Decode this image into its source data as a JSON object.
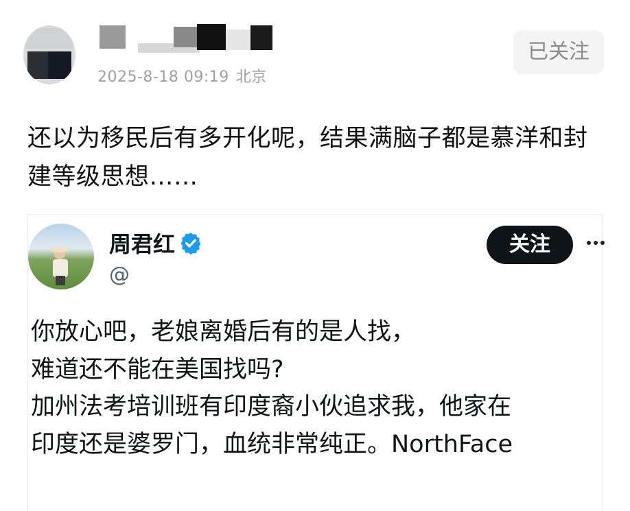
{
  "post": {
    "author_name": "",
    "timestamp": "2025-8-18 09:19",
    "location": "北京",
    "follow_status_label": "已关注",
    "text": "还以为移民后有多开化呢，结果满脑子都是慕洋和封建等级思想……"
  },
  "embedded_tweet": {
    "author_name": "周君红",
    "verified": true,
    "handle": "@",
    "follow_label": "关注",
    "more_icon": "more-horizontal-icon",
    "lines": [
      "你放心吧，老娘离婚后有的是人找，",
      "难道还不能在美国找吗?",
      "加州法考培训班有印度裔小伙追求我，他家在",
      "印度还是婆罗门，血统非常纯正。NorthFace"
    ]
  },
  "colors": {
    "verified_blue": "#1d9bf0",
    "follow_button_bg": "#0f1419",
    "meta_gray": "#a0a0a0"
  }
}
